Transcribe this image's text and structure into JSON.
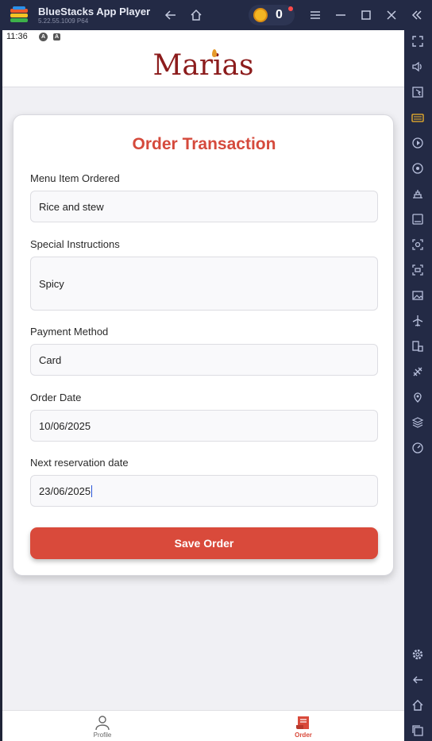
{
  "window": {
    "title": "BlueStacks App Player",
    "version": "5.22.55.1009  P64",
    "coin_count": "0"
  },
  "status": {
    "time": "11:36",
    "icon1": "A",
    "icon2": "A"
  },
  "app": {
    "brand": "Marias"
  },
  "form": {
    "title": "Order Transaction",
    "fields": [
      {
        "label": "Menu Item Ordered",
        "value": "Rice and stew"
      },
      {
        "label": "Special Instructions",
        "value": "Spicy"
      },
      {
        "label": "Payment Method",
        "value": "Card"
      },
      {
        "label": "Order Date",
        "value": "10/06/2025"
      },
      {
        "label": "Next reservation date",
        "value": "23/06/2025"
      }
    ],
    "save_label": "Save Order"
  },
  "nav": {
    "items": [
      {
        "label": "Profile",
        "icon": "person-icon",
        "active": false
      },
      {
        "label": "Order",
        "icon": "order-icon",
        "active": true
      }
    ],
    "active_color": "#d94a3b",
    "inactive_color": "#777777"
  },
  "colors": {
    "accent": "#d94a3b",
    "brand": "#8c1c1c",
    "chrome": "#232a45"
  }
}
